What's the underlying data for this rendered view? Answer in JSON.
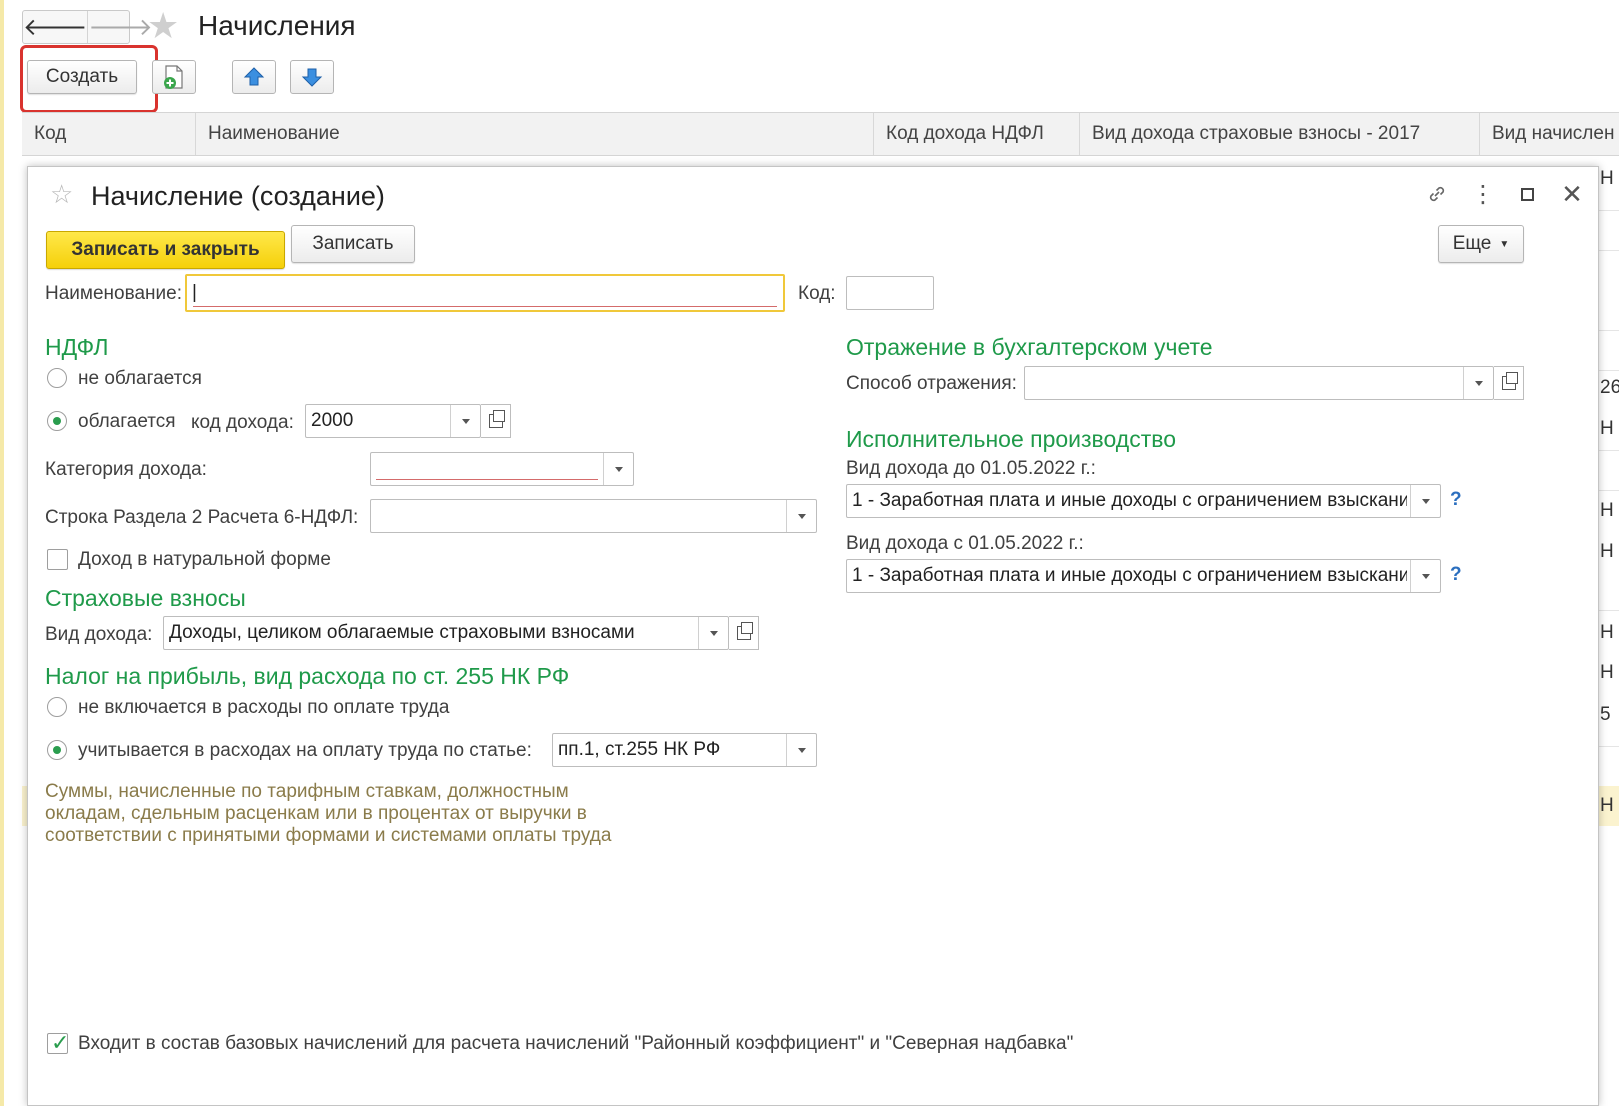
{
  "window": {
    "title": "Начисления"
  },
  "toolbar": {
    "back_label": "🡐",
    "forward_label": "🡒",
    "create_label": "Создать"
  },
  "list": {
    "columns": [
      "Код",
      "Наименование",
      "Код дохода НДФЛ",
      "Вид дохода страховые взносы - 2017",
      "Вид начислен"
    ],
    "visible_cells": [
      "Н",
      "Н",
      "26",
      "Н",
      "Н",
      "Н",
      "Н",
      "Н",
      "5",
      "Н"
    ]
  },
  "dialog": {
    "title": "Начисление (создание)",
    "save_close_label": "Записать и закрыть",
    "save_label": "Записать",
    "more_label": "Еще",
    "name_label": "Наименование:",
    "name_value": "|",
    "code_label": "Код:",
    "code_value": "",
    "ndfl": {
      "title": "НДФЛ",
      "not_taxed_label": "не облагается",
      "taxed_label": "облагается",
      "income_code_label": "код дохода:",
      "income_code_value": "2000",
      "category_label": "Категория дохода:",
      "category_value": "",
      "line_6ndfl_label": "Строка Раздела 2 Расчета 6-НДФЛ:",
      "line_6ndfl_value": "",
      "natural_form_label": "Доход в натуральной форме"
    },
    "insurance": {
      "title": "Страховые взносы",
      "income_type_label": "Вид дохода:",
      "income_type_value": "Доходы, целиком облагаемые страховыми взносами"
    },
    "profit_tax": {
      "title": "Налог на прибыль, вид расхода по ст. 255 НК РФ",
      "not_included_label": "не включается в расходы по оплате труда",
      "included_label": "учитывается в расходах на оплату труда по статье:",
      "article_value": "пп.1, ст.255 НК РФ",
      "note": "Суммы, начисленные по тарифным ставкам, должностным окладам, сдельным расценкам или в процентах от выручки в соответствии с принятыми формами и системами оплаты труда"
    },
    "accounting": {
      "title": "Отражение в бухгалтерском учете",
      "method_label": "Способ отражения:",
      "method_value": ""
    },
    "enforcement": {
      "title": "Исполнительное производство",
      "before_label": "Вид дохода до 01.05.2022 г.:",
      "before_value": "1 - Заработная плата и иные доходы с ограничением взыскани",
      "after_label": "Вид дохода с 01.05.2022 г.:",
      "after_value": "1 - Заработная плата и иные доходы с ограничением взыскани",
      "help_label": "?"
    },
    "base_accruals_label": "Входит в состав базовых начислений для расчета начислений \"Районный коэффициент\" и \"Северная надбавка\""
  }
}
